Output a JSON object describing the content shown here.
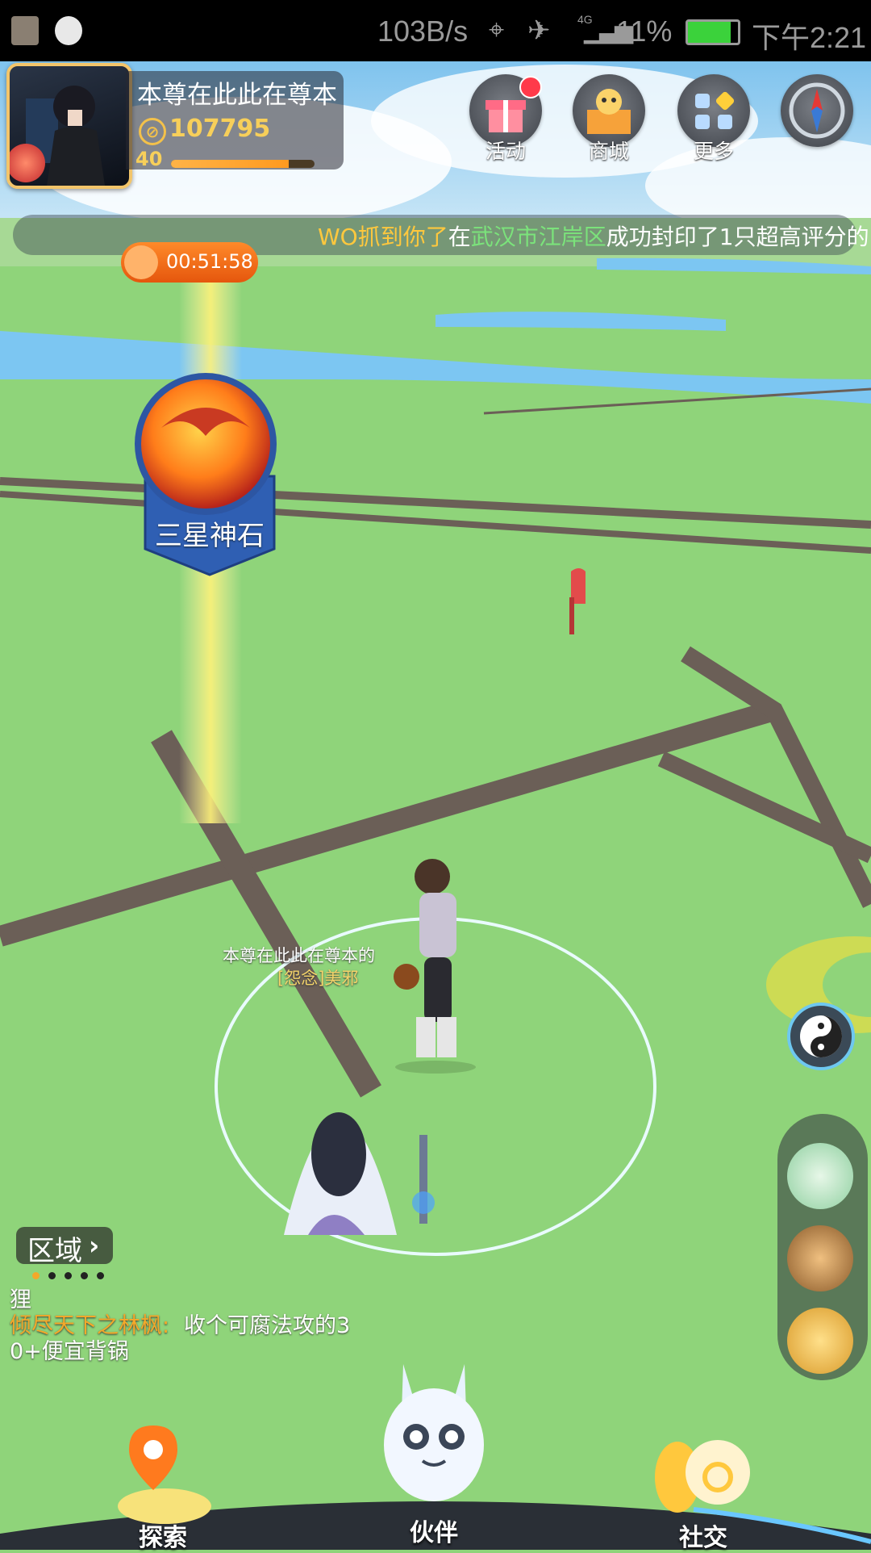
{
  "status_bar": {
    "net_speed": "103B/s",
    "battery_pct": "11%",
    "time": "下午2:21",
    "signal": "4G"
  },
  "profile": {
    "nickname": "本尊在此此在尊本",
    "coins": "107795",
    "level": "40",
    "xp_fraction": 0.82
  },
  "top_buttons": [
    {
      "label": "活动",
      "icon": "gift-icon",
      "badge": true
    },
    {
      "label": "商城",
      "icon": "shop-icon",
      "badge": false
    },
    {
      "label": "更多",
      "icon": "grid-icon",
      "badge": false
    }
  ],
  "marquee": {
    "part1": "WO抓到你了",
    "part2": "在",
    "part3": "武汉市江岸区",
    "part4": "成功封印了1只超高评分的"
  },
  "timer": "00:51:58",
  "map_marker": {
    "label": "三星神石"
  },
  "player": {
    "name": "本尊在此此在尊本的",
    "title": "[怨念]美邪"
  },
  "region_button": {
    "label": "区域"
  },
  "chat": {
    "line1": "狸",
    "line2_name": "倾尽天下之林枫:",
    "line2_text": "收个可腐法攻的3",
    "line3": "0+便宜背锅"
  },
  "bottom_nav": [
    {
      "label": "探索",
      "icon": "map-pin-icon"
    },
    {
      "label": "伙伴",
      "icon": "ghost-companion-icon"
    },
    {
      "label": "社交",
      "icon": "social-icon"
    }
  ],
  "colors": {
    "map_green": "#8fd47a",
    "road": "#6b5f57",
    "water": "#7cc6f2",
    "accent_orange": "#ff7a1e",
    "gold": "#f7cf5a"
  }
}
